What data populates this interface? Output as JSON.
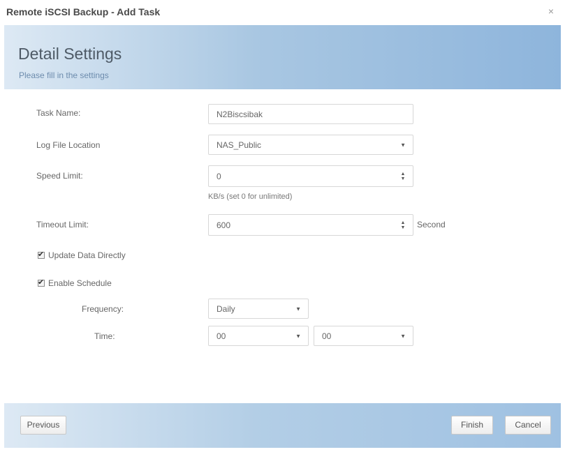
{
  "window": {
    "title": "Remote iSCSI Backup - Add Task",
    "close_glyph": "×"
  },
  "header": {
    "title": "Detail Settings",
    "subtitle": "Please fill in the settings"
  },
  "form": {
    "task_name": {
      "label": "Task Name:",
      "value": "N2Biscsibak"
    },
    "log_file_location": {
      "label": "Log File Location",
      "value": "NAS_Public"
    },
    "speed_limit": {
      "label": "Speed Limit:",
      "value": "0",
      "hint": "KB/s (set 0 for unlimited)"
    },
    "timeout_limit": {
      "label": "Timeout Limit:",
      "value": "600",
      "unit": "Second"
    },
    "update_data_directly": {
      "label": "Update Data Directly",
      "checked": true
    },
    "enable_schedule": {
      "label": "Enable Schedule",
      "checked": true
    },
    "frequency": {
      "label": "Frequency:",
      "value": "Daily"
    },
    "time": {
      "label": "Time:",
      "hour": "00",
      "minute": "00"
    }
  },
  "footer": {
    "previous_label": "Previous",
    "finish_label": "Finish",
    "cancel_label": "Cancel"
  },
  "icons": {
    "dropdown": "chevron-down-icon",
    "spinner": "spinner-arrows-icon",
    "checkbox": "checkmark-icon",
    "close": "close-icon"
  },
  "colors": {
    "header_gradient_start": "#dde9f4",
    "header_gradient_end": "#8eb5dc",
    "title_text": "#4e5a66",
    "subtitle_text": "#6d8cad"
  }
}
